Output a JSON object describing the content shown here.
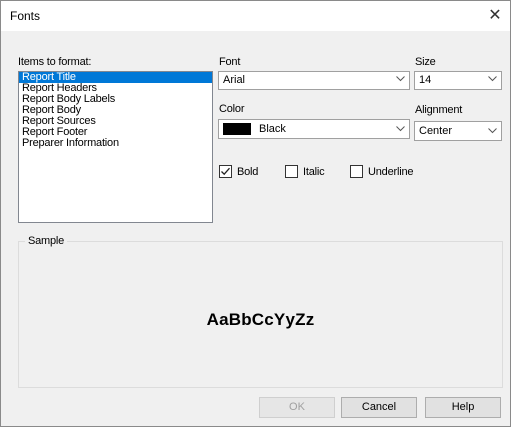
{
  "window": {
    "title": "Fonts",
    "close_glyph": "✕"
  },
  "items": {
    "label": "Items to format:",
    "list": [
      "Report Title",
      "Report Headers",
      "Report Body Labels",
      "Report Body",
      "Report Sources",
      "Report Footer",
      "Preparer Information"
    ],
    "selected_index": 0
  },
  "font": {
    "label": "Font",
    "value": "Arial"
  },
  "size": {
    "label": "Size",
    "value": "14"
  },
  "color": {
    "label": "Color",
    "value": "Black",
    "swatch": "#000000"
  },
  "alignment": {
    "label": "Alignment",
    "value": "Center"
  },
  "styles": {
    "bold": {
      "label": "Bold",
      "checked": true
    },
    "italic": {
      "label": "Italic",
      "checked": false
    },
    "underline": {
      "label": "Underline",
      "checked": false
    }
  },
  "sample": {
    "title": "Sample",
    "text": "AaBbCcYyZz"
  },
  "buttons": {
    "ok": "OK",
    "cancel": "Cancel",
    "help": "Help"
  },
  "colors": {
    "accent": "#0078d7",
    "dialog_bg": "#f0f0f0"
  },
  "icons": {
    "close": "close-icon",
    "dropdown": "chevron-down-icon",
    "check": "checkmark-icon"
  }
}
